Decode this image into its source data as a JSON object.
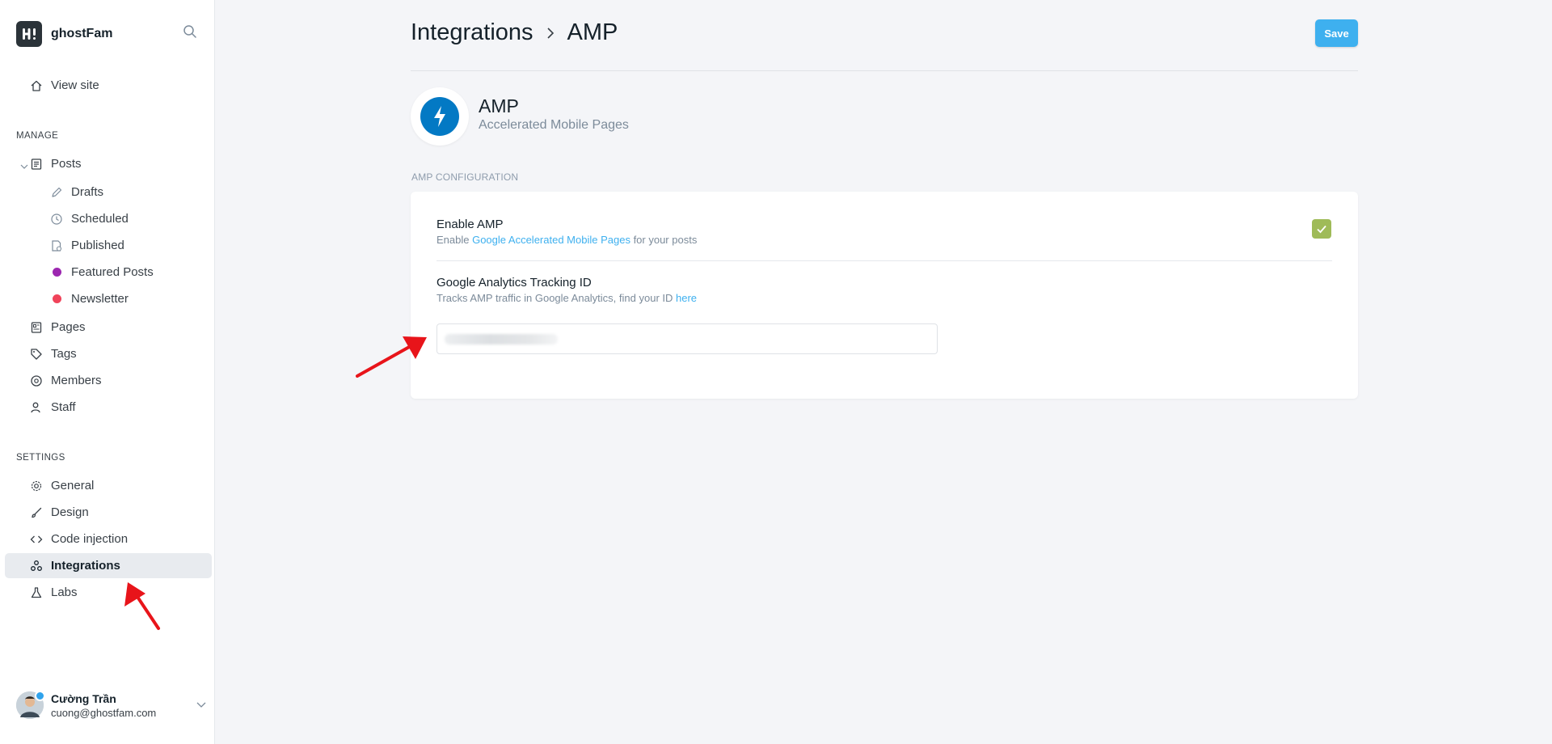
{
  "brand": {
    "name": "ghostFam"
  },
  "sidebar": {
    "view_site": "View site",
    "manage_label": "MANAGE",
    "posts": "Posts",
    "post_subitems": [
      {
        "label": "Drafts"
      },
      {
        "label": "Scheduled"
      },
      {
        "label": "Published"
      },
      {
        "label": "Featured Posts",
        "color": "#9c27b0"
      },
      {
        "label": "Newsletter",
        "color": "#f0435a"
      }
    ],
    "manage_items": [
      "Pages",
      "Tags",
      "Members",
      "Staff"
    ],
    "settings_label": "SETTINGS",
    "settings_items": [
      "General",
      "Design",
      "Code injection",
      "Integrations",
      "Labs"
    ],
    "active_item": "Integrations"
  },
  "user": {
    "name": "Cường Trần",
    "email": "cuong@ghostfam.com"
  },
  "header": {
    "crumb_parent": "Integrations",
    "crumb_current": "AMP",
    "save_label": "Save"
  },
  "app": {
    "title": "AMP",
    "subtitle": "Accelerated Mobile Pages",
    "icon": "lightning-bolt-icon",
    "icon_color": "#0379c4"
  },
  "config": {
    "section_label": "AMP CONFIGURATION",
    "enable": {
      "title": "Enable AMP",
      "desc_prefix": "Enable ",
      "desc_link": "Google Accelerated Mobile Pages",
      "desc_suffix": " for your posts",
      "checked": true
    },
    "tracking": {
      "title": "Google Analytics Tracking ID",
      "desc_prefix": "Tracks AMP traffic in Google Analytics, find your ID ",
      "desc_link": "here",
      "value_blurred": true
    }
  },
  "colors": {
    "accent": "#3eb0ef",
    "checkbox": "#9fbb58",
    "active_bg": "#e8ebef",
    "annotation_arrow": "#e8141a"
  }
}
